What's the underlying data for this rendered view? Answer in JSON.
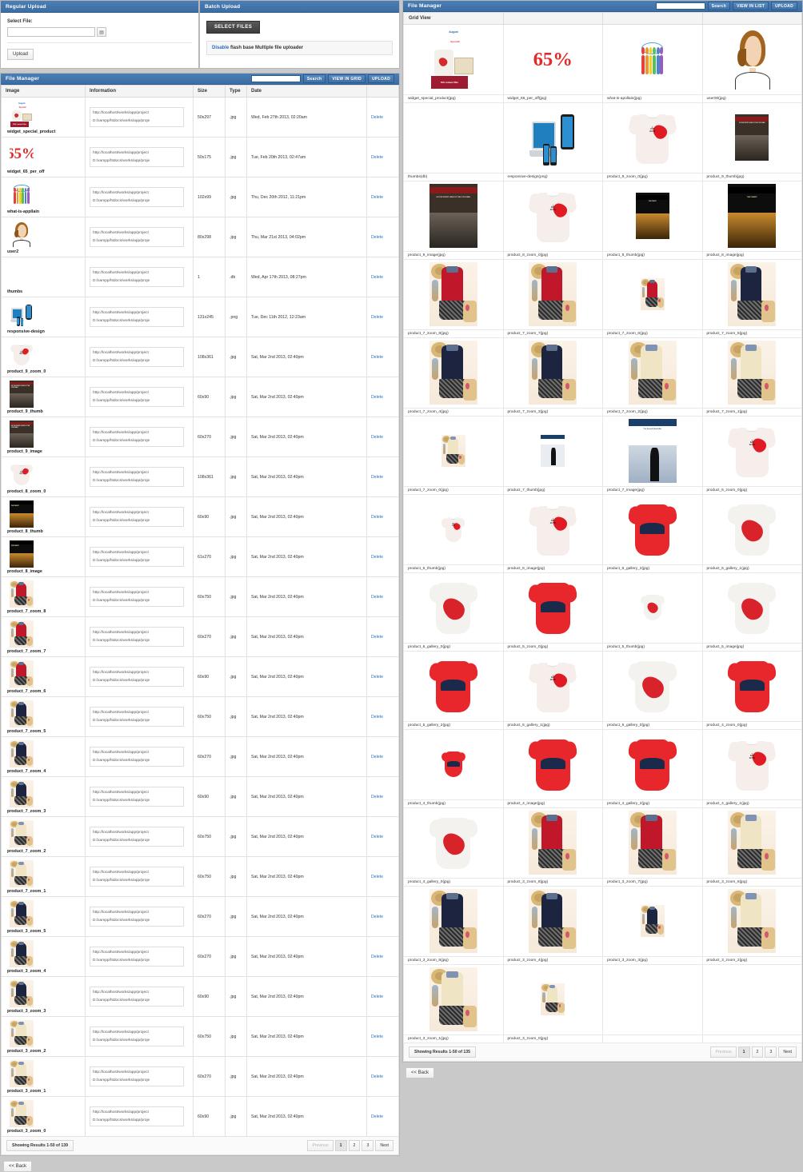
{
  "colors": {
    "brand": "#3d6da3",
    "link": "#2a6ebb",
    "danger": "#e02b2b",
    "dark_btn": "#3d3d3d"
  },
  "regular_upload": {
    "title": "Regular Upload",
    "select_file_label": "Select File:",
    "file_input_value": "",
    "browse_icon": "folder-icon",
    "upload_label": "Upload"
  },
  "batch_upload": {
    "title": "Batch Upload",
    "select_files_label": "SELECT FILES",
    "note_link": "Disable",
    "note_text": " flash base Multiple file uploader"
  },
  "file_manager_list": {
    "title": "File Manager",
    "search_value": "",
    "search_placeholder": "",
    "search_label": "Search",
    "view_toggle_label": "VIEW IN GRID",
    "upload_label": "UPLOAD",
    "columns": [
      "Image",
      "Information",
      "Size",
      "Type",
      "Date",
      ""
    ],
    "delete_label": "Delete",
    "url_line": "http://localhost/works/app/project",
    "path_line": "D:/xampp/htdocs/works/app/proje",
    "rows": [
      {
        "name": "widget_special_product",
        "size": "50x297",
        "type": "jpg",
        "date": "Wed, Feb 27th 2013, 02:20am",
        "art": "aug"
      },
      {
        "name": "widget_65_per_off",
        "size": "50x175",
        "type": "jpg",
        "date": "Tue, Feb 20th 2013, 02:47am",
        "art": "65"
      },
      {
        "name": "what-is-appllain",
        "size": "102x99",
        "type": "jpg",
        "date": "Thu, Dec 20th 2012, 11:21pm",
        "art": "people"
      },
      {
        "name": "user2",
        "size": "80x298",
        "type": "jpg",
        "date": "Thu, Mar 21st 2013, 04:02pm",
        "art": "user"
      },
      {
        "name": "thumbs",
        "size": "1",
        "type": "db",
        "date": "Wed, Apr 17th 2013, 08:27pm",
        "art": "none"
      },
      {
        "name": "responsive-design",
        "size": "131x245",
        "type": "png",
        "date": "Tue, Dec 11th 2012, 12:23am",
        "art": "dev"
      },
      {
        "name": "product_9_zoom_0",
        "size": "108x361",
        "type": "jpg",
        "date": "Sat, Mar 2nd 2013, 02:40pm",
        "art": "tee"
      },
      {
        "name": "product_9_thumb",
        "size": "60x90",
        "type": "jpg",
        "date": "Sat, Mar 2nd 2013, 02:40pm",
        "art": "cold"
      },
      {
        "name": "product_9_image",
        "size": "60x270",
        "type": "jpg",
        "date": "Sat, Mar 2nd 2013, 02:40pm",
        "art": "cold"
      },
      {
        "name": "product_8_zoom_0",
        "size": "108x361",
        "type": "jpg",
        "date": "Sat, Mar 2nd 2013, 02:40pm",
        "art": "tee"
      },
      {
        "name": "product_8_thumb",
        "size": "60x90",
        "type": "jpg",
        "date": "Sat, Mar 2nd 2013, 02:40pm",
        "art": "pianist"
      },
      {
        "name": "product_8_image",
        "size": "61x270",
        "type": "jpg",
        "date": "Sat, Mar 2nd 2013, 02:40pm",
        "art": "pianist"
      },
      {
        "name": "product_7_zoom_8",
        "size": "60x750",
        "type": "jpg",
        "date": "Sat, Mar 2nd 2013, 02:40pm",
        "art": "outfit-red"
      },
      {
        "name": "product_7_zoom_7",
        "size": "60x270",
        "type": "jpg",
        "date": "Sat, Mar 2nd 2013, 02:40pm",
        "art": "outfit-red"
      },
      {
        "name": "product_7_zoom_6",
        "size": "60x90",
        "type": "jpg",
        "date": "Sat, Mar 2nd 2013, 02:40pm",
        "art": "outfit-red"
      },
      {
        "name": "product_7_zoom_5",
        "size": "60x750",
        "type": "jpg",
        "date": "Sat, Mar 2nd 2013, 02:40pm",
        "art": "outfit-navy"
      },
      {
        "name": "product_7_zoom_4",
        "size": "60x270",
        "type": "jpg",
        "date": "Sat, Mar 2nd 2013, 02:40pm",
        "art": "outfit-navy"
      },
      {
        "name": "product_7_zoom_3",
        "size": "60x90",
        "type": "jpg",
        "date": "Sat, Mar 2nd 2013, 02:40pm",
        "art": "outfit-navy"
      },
      {
        "name": "product_7_zoom_2",
        "size": "60x750",
        "type": "jpg",
        "date": "Sat, Mar 2nd 2013, 02:40pm",
        "art": "outfit-cream"
      },
      {
        "name": "product_7_zoom_1",
        "size": "60x750",
        "type": "jpg",
        "date": "Sat, Mar 2nd 2013, 02:40pm",
        "art": "outfit-cream"
      },
      {
        "name": "product_3_zoom_5",
        "size": "60x270",
        "type": "jpg",
        "date": "Sat, Mar 2nd 2013, 02:40pm",
        "art": "outfit-navy"
      },
      {
        "name": "product_3_zoom_4",
        "size": "60x270",
        "type": "jpg",
        "date": "Sat, Mar 2nd 2013, 02:40pm",
        "art": "outfit-navy"
      },
      {
        "name": "product_3_zoom_3",
        "size": "60x90",
        "type": "jpg",
        "date": "Sat, Mar 2nd 2013, 02:40pm",
        "art": "outfit-navy"
      },
      {
        "name": "product_3_zoom_2",
        "size": "60x750",
        "type": "jpg",
        "date": "Sat, Mar 2nd 2013, 02:40pm",
        "art": "outfit-cream"
      },
      {
        "name": "product_3_zoom_1",
        "size": "60x270",
        "type": "jpg",
        "date": "Sat, Mar 2nd 2013, 02:40pm",
        "art": "outfit-cream"
      },
      {
        "name": "product_3_zoom_0",
        "size": "60x90",
        "type": "jpg",
        "date": "Sat, Mar 2nd 2013, 02:40pm",
        "art": "outfit-cream"
      }
    ],
    "results_text": "Showing Results 1-50 of 139",
    "pagination": {
      "previous": "Previous",
      "pages": [
        "1",
        "2",
        "3"
      ],
      "active": "1",
      "next": "Next"
    },
    "back_label": "<< Back"
  },
  "file_manager_grid": {
    "title": "File Manager",
    "search_value": "",
    "search_label": "Search",
    "view_toggle_label": "VIEW IN LIST",
    "upload_label": "UPLOAD",
    "grid_view_label": "Grid View",
    "results_text": "Showing Results 1-50 of 135",
    "pagination": {
      "previous": "Previous",
      "pages": [
        "1",
        "2",
        "3"
      ],
      "active": "1",
      "next": "Next"
    },
    "back_label": "<< Back",
    "cells": [
      {
        "caption": "widget_special_product(jpg)",
        "art": "aug",
        "size": "big"
      },
      {
        "caption": "widget_65_per_off(jpg)",
        "art": "65",
        "size": "big"
      },
      {
        "caption": "what-is-apollain(jpg)",
        "art": "people",
        "size": "mid"
      },
      {
        "caption": "user00(jpg)",
        "art": "user",
        "size": "big"
      },
      {
        "caption": "thumbs(db)",
        "art": "none",
        "size": "big"
      },
      {
        "caption": "responsive-design(png)",
        "art": "dev",
        "size": "big"
      },
      {
        "caption": "product_9_zoom_0(jpg)",
        "art": "tee",
        "size": "big"
      },
      {
        "caption": "product_9_thumb(jpg)",
        "art": "cold",
        "size": "mid"
      },
      {
        "caption": "product_9_image(jpg)",
        "art": "cold",
        "size": "big"
      },
      {
        "caption": "product_8_zoom_0(jpg)",
        "art": "tee",
        "size": "big"
      },
      {
        "caption": "product_8_thumb(jpg)",
        "art": "pianist",
        "size": "mid"
      },
      {
        "caption": "product_8_image(jpg)",
        "art": "pianist",
        "size": "big"
      },
      {
        "caption": "product_7_zoom_8(jpg)",
        "art": "outfit-red",
        "size": "big"
      },
      {
        "caption": "product_7_zoom_7(jpg)",
        "art": "outfit-red",
        "size": "big"
      },
      {
        "caption": "product_7_zoom_6(jpg)",
        "art": "outfit-red",
        "size": "small"
      },
      {
        "caption": "product_7_zoom_5(jpg)",
        "art": "outfit-navy",
        "size": "big"
      },
      {
        "caption": "product_7_zoom_4(jpg)",
        "art": "outfit-navy",
        "size": "big"
      },
      {
        "caption": "product_7_zoom_3(jpg)",
        "art": "outfit-navy",
        "size": "big"
      },
      {
        "caption": "product_7_zoom_2(jpg)",
        "art": "outfit-cream",
        "size": "big"
      },
      {
        "caption": "product_7_zoom_1(jpg)",
        "art": "outfit-cream",
        "size": "big"
      },
      {
        "caption": "product_7_zoom_0(jpg)",
        "art": "outfit-cream",
        "size": "small"
      },
      {
        "caption": "product_7_thumb(jpg)",
        "art": "churchill",
        "size": "small"
      },
      {
        "caption": "product_7_image(jpg)",
        "art": "wwii",
        "size": "big"
      },
      {
        "caption": "product_6_zoom_0(jpg)",
        "art": "tee",
        "size": "big"
      },
      {
        "caption": "product_6_thumb(jpg)",
        "art": "tee",
        "size": "small"
      },
      {
        "caption": "product_6_image(jpg)",
        "art": "tee",
        "size": "big"
      },
      {
        "caption": "product_6_gallery_2(jpg)",
        "art": "htee-red",
        "size": "big"
      },
      {
        "caption": "product_6_gallery_1(jpg)",
        "art": "htee",
        "size": "big"
      },
      {
        "caption": "product_6_gallery_0(jpg)",
        "art": "htee",
        "size": "big"
      },
      {
        "caption": "product_5_zoom_0(jpg)",
        "art": "htee-red",
        "size": "big"
      },
      {
        "caption": "product_5_thumb(jpg)",
        "art": "htee",
        "size": "small"
      },
      {
        "caption": "product_5_image(jpg)",
        "art": "htee",
        "size": "big"
      },
      {
        "caption": "product_5_gallery_2(jpg)",
        "art": "htee-red",
        "size": "big"
      },
      {
        "caption": "product_5_gallery_1(jpg)",
        "art": "tee",
        "size": "big"
      },
      {
        "caption": "product_5_gallery_0(jpg)",
        "art": "htee",
        "size": "big"
      },
      {
        "caption": "product_4_zoom_0(jpg)",
        "art": "htee-red",
        "size": "big"
      },
      {
        "caption": "product_4_thumb(jpg)",
        "art": "htee-red",
        "size": "small"
      },
      {
        "caption": "product_4_image(jpg)",
        "art": "htee-red",
        "size": "big"
      },
      {
        "caption": "product_4_gallery_2(jpg)",
        "art": "htee-red",
        "size": "big"
      },
      {
        "caption": "product_4_gallery_1(jpg)",
        "art": "tee",
        "size": "big"
      },
      {
        "caption": "product_4_gallery_0(jpg)",
        "art": "htee",
        "size": "big"
      },
      {
        "caption": "product_3_zoom_8(jpg)",
        "art": "outfit-red",
        "size": "big"
      },
      {
        "caption": "product_3_zoom_7(jpg)",
        "art": "outfit-red",
        "size": "big"
      },
      {
        "caption": "product_3_zoom_6(jpg)",
        "art": "outfit-cream",
        "size": "big"
      },
      {
        "caption": "product_3_zoom_5(jpg)",
        "art": "outfit-navy",
        "size": "big"
      },
      {
        "caption": "product_3_zoom_4(jpg)",
        "art": "outfit-navy",
        "size": "big"
      },
      {
        "caption": "product_3_zoom_3(jpg)",
        "art": "outfit-navy",
        "size": "small"
      },
      {
        "caption": "product_3_zoom_2(jpg)",
        "art": "outfit-cream",
        "size": "big"
      },
      {
        "caption": "product_3_zoom_1(jpg)",
        "art": "outfit-cream",
        "size": "big"
      },
      {
        "caption": "product_3_zoom_0(jpg)",
        "art": "outfit-cream",
        "size": "small"
      },
      {
        "caption": "",
        "art": "none",
        "size": "big"
      },
      {
        "caption": "",
        "art": "none",
        "size": "big"
      }
    ]
  }
}
